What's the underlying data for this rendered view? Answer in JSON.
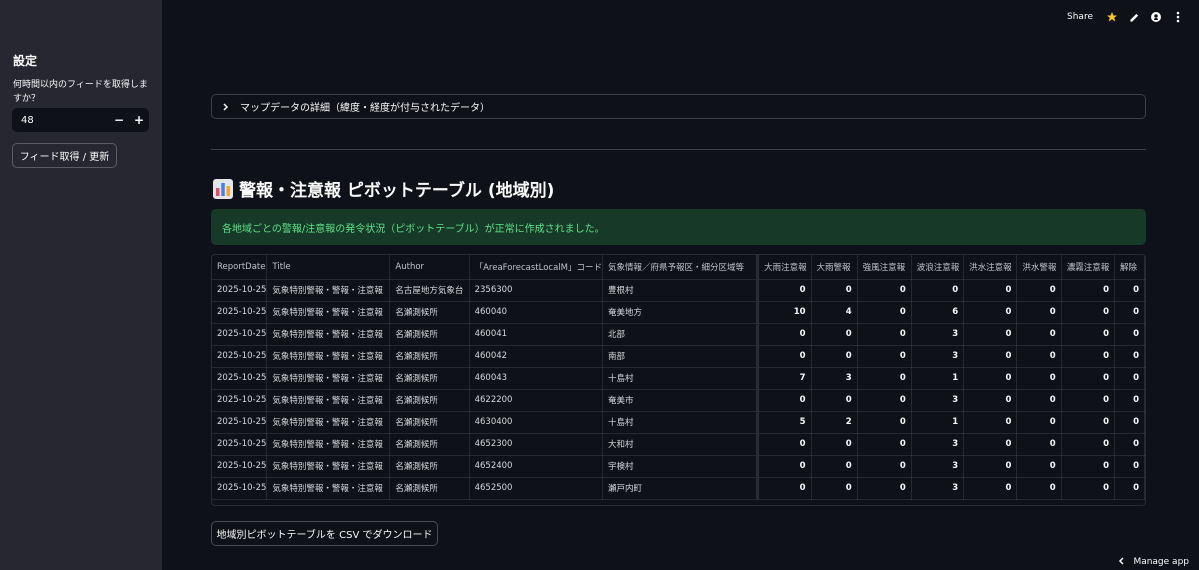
{
  "sidebar": {
    "title": "設定",
    "hours_label": "何時間以内のフィードを取得しますか？",
    "hours_value": "48",
    "minus": "−",
    "plus": "+",
    "fetch_button": "フィード取得 / 更新"
  },
  "topbar": {
    "share": "Share",
    "icons": [
      "star-icon",
      "edit-icon",
      "github-icon",
      "more-icon"
    ]
  },
  "expander": {
    "label": "マップデータの詳細（緯度・経度が付与されたデータ）"
  },
  "heading": {
    "text": "警報・注意報 ピボットテーブル (地域別)"
  },
  "alert": {
    "text": "各地域ごとの警報/注意報の発令状況（ピボットテーブル）が正常に作成されました。"
  },
  "table": {
    "columns": [
      "ReportDate",
      "Title",
      "Author",
      "「AreaForecastLocalM」コード",
      "気象情報／府県予報区・細分区域等",
      "大雨注意報",
      "大雨警報",
      "強風注意報",
      "波浪注意報",
      "洪水注意報",
      "洪水警報",
      "濃霧注意報",
      "解除"
    ],
    "rows": [
      [
        "2025-10-25",
        "気象特別警報・警報・注意報",
        "名古屋地方気象台",
        "2356300",
        "豊根村",
        "0",
        "0",
        "0",
        "0",
        "0",
        "0",
        "0",
        "0"
      ],
      [
        "2025-10-25",
        "気象特別警報・警報・注意報",
        "名瀬測候所",
        "460040",
        "奄美地方",
        "10",
        "4",
        "0",
        "6",
        "0",
        "0",
        "0",
        "0"
      ],
      [
        "2025-10-25",
        "気象特別警報・警報・注意報",
        "名瀬測候所",
        "460041",
        "北部",
        "0",
        "0",
        "0",
        "3",
        "0",
        "0",
        "0",
        "0"
      ],
      [
        "2025-10-25",
        "気象特別警報・警報・注意報",
        "名瀬測候所",
        "460042",
        "南部",
        "0",
        "0",
        "0",
        "3",
        "0",
        "0",
        "0",
        "0"
      ],
      [
        "2025-10-25",
        "気象特別警報・警報・注意報",
        "名瀬測候所",
        "460043",
        "十島村",
        "7",
        "3",
        "0",
        "1",
        "0",
        "0",
        "0",
        "0"
      ],
      [
        "2025-10-25",
        "気象特別警報・警報・注意報",
        "名瀬測候所",
        "4622200",
        "奄美市",
        "0",
        "0",
        "0",
        "3",
        "0",
        "0",
        "0",
        "0"
      ],
      [
        "2025-10-25",
        "気象特別警報・警報・注意報",
        "名瀬測候所",
        "4630400",
        "十島村",
        "5",
        "2",
        "0",
        "1",
        "0",
        "0",
        "0",
        "0"
      ],
      [
        "2025-10-25",
        "気象特別警報・警報・注意報",
        "名瀬測候所",
        "4652300",
        "大和村",
        "0",
        "0",
        "0",
        "3",
        "0",
        "0",
        "0",
        "0"
      ],
      [
        "2025-10-25",
        "気象特別警報・警報・注意報",
        "名瀬測候所",
        "4652400",
        "宇検村",
        "0",
        "0",
        "0",
        "3",
        "0",
        "0",
        "0",
        "0"
      ],
      [
        "2025-10-25",
        "気象特別警報・警報・注意報",
        "名瀬測候所",
        "4652500",
        "瀬戸内町",
        "0",
        "0",
        "0",
        "3",
        "0",
        "0",
        "0",
        "0"
      ]
    ]
  },
  "download_button": "地域別ピボットテーブルを CSV でダウンロード",
  "manage_app": "Manage app",
  "colors": {
    "sidebar_bg": "#262730",
    "main_bg": "#0e1117",
    "success_bg": "#173928",
    "success_text": "#5ce488",
    "star": "#f7c52b"
  }
}
